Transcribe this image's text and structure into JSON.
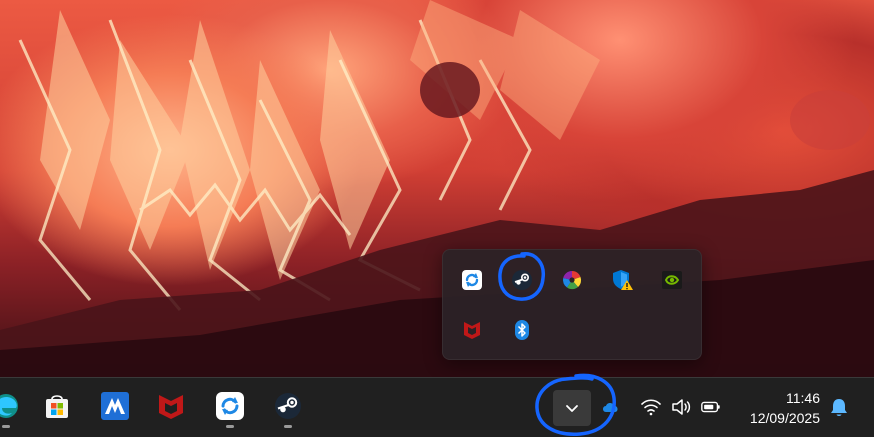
{
  "desktop": {
    "wallpaper": "abstract red and orange crystalline landscape"
  },
  "tray_overflow": {
    "icons": [
      {
        "name": "sync-app-icon",
        "color": "#1e88e5"
      },
      {
        "name": "steam-icon",
        "color": "#1b2838"
      },
      {
        "name": "color-wheel-icon",
        "color": "#e53935"
      },
      {
        "name": "windows-security-warning-icon",
        "color": "#0078d4"
      },
      {
        "name": "nvidia-icon",
        "color": "#76b900"
      },
      {
        "name": "mcafee-icon",
        "color": "#c01818"
      },
      {
        "name": "bluetooth-icon",
        "color": "#1e88e5"
      }
    ]
  },
  "taskbar": {
    "apps": [
      {
        "name": "edge-icon",
        "running": true
      },
      {
        "name": "microsoft-store-icon",
        "running": false
      },
      {
        "name": "malwarebytes-icon",
        "running": false
      },
      {
        "name": "mcafee-icon",
        "running": false
      },
      {
        "name": "sync-app-icon",
        "running": true
      },
      {
        "name": "steam-icon",
        "running": true
      }
    ],
    "accent_color": "#1e88e5"
  },
  "clock": {
    "time": "11:46",
    "date": "12/09/2025"
  },
  "annotations": {
    "circle_color": "#1565ff"
  }
}
